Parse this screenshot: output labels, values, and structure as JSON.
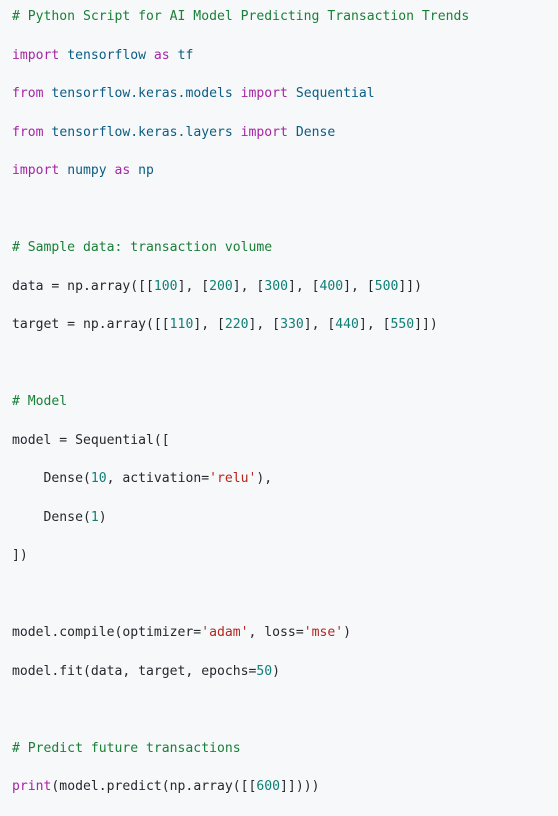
{
  "code": {
    "language": "python",
    "lines": [
      [
        {
          "t": "# Python Script for AI Model Predicting Transaction Trends",
          "c": "comment"
        }
      ],
      [
        {
          "t": "import",
          "c": "kw"
        },
        {
          "t": " tensorflow ",
          "c": "mod"
        },
        {
          "t": "as",
          "c": "kw"
        },
        {
          "t": " tf",
          "c": "mod"
        }
      ],
      [
        {
          "t": "from",
          "c": "kw"
        },
        {
          "t": " tensorflow.keras.models ",
          "c": "mod"
        },
        {
          "t": "import",
          "c": "kw"
        },
        {
          "t": " Sequential",
          "c": "mod"
        }
      ],
      [
        {
          "t": "from",
          "c": "kw"
        },
        {
          "t": " tensorflow.keras.layers ",
          "c": "mod"
        },
        {
          "t": "import",
          "c": "kw"
        },
        {
          "t": " Dense",
          "c": "mod"
        }
      ],
      [
        {
          "t": "import",
          "c": "kw"
        },
        {
          "t": " numpy ",
          "c": "mod"
        },
        {
          "t": "as",
          "c": "kw"
        },
        {
          "t": " np",
          "c": "mod"
        }
      ],
      [],
      [
        {
          "t": "# Sample data: transaction volume",
          "c": "comment"
        }
      ],
      [
        {
          "t": "data = np.array([[",
          "c": "fn"
        },
        {
          "t": "100",
          "c": "num"
        },
        {
          "t": "], [",
          "c": "fn"
        },
        {
          "t": "200",
          "c": "num"
        },
        {
          "t": "], [",
          "c": "fn"
        },
        {
          "t": "300",
          "c": "num"
        },
        {
          "t": "], [",
          "c": "fn"
        },
        {
          "t": "400",
          "c": "num"
        },
        {
          "t": "], [",
          "c": "fn"
        },
        {
          "t": "500",
          "c": "num"
        },
        {
          "t": "]])",
          "c": "fn"
        }
      ],
      [
        {
          "t": "target = np.array([[",
          "c": "fn"
        },
        {
          "t": "110",
          "c": "num"
        },
        {
          "t": "], [",
          "c": "fn"
        },
        {
          "t": "220",
          "c": "num"
        },
        {
          "t": "], [",
          "c": "fn"
        },
        {
          "t": "330",
          "c": "num"
        },
        {
          "t": "], [",
          "c": "fn"
        },
        {
          "t": "440",
          "c": "num"
        },
        {
          "t": "], [",
          "c": "fn"
        },
        {
          "t": "550",
          "c": "num"
        },
        {
          "t": "]])",
          "c": "fn"
        }
      ],
      [],
      [
        {
          "t": "# Model",
          "c": "comment"
        }
      ],
      [
        {
          "t": "model = Sequential([",
          "c": "fn"
        }
      ],
      [
        {
          "t": "    Dense(",
          "c": "fn"
        },
        {
          "t": "10",
          "c": "num"
        },
        {
          "t": ", activation=",
          "c": "fn"
        },
        {
          "t": "'relu'",
          "c": "str"
        },
        {
          "t": "),",
          "c": "fn"
        }
      ],
      [
        {
          "t": "    Dense(",
          "c": "fn"
        },
        {
          "t": "1",
          "c": "num"
        },
        {
          "t": ")",
          "c": "fn"
        }
      ],
      [
        {
          "t": "])",
          "c": "fn"
        }
      ],
      [],
      [
        {
          "t": "model.compile(optimizer=",
          "c": "fn"
        },
        {
          "t": "'adam'",
          "c": "str"
        },
        {
          "t": ", loss=",
          "c": "fn"
        },
        {
          "t": "'mse'",
          "c": "str"
        },
        {
          "t": ")",
          "c": "fn"
        }
      ],
      [
        {
          "t": "model.fit(data, target, epochs=",
          "c": "fn"
        },
        {
          "t": "50",
          "c": "num"
        },
        {
          "t": ")",
          "c": "fn"
        }
      ],
      [],
      [
        {
          "t": "# Predict future transactions",
          "c": "comment"
        }
      ],
      [
        {
          "t": "print",
          "c": "kw"
        },
        {
          "t": "(model.predict(np.array([[",
          "c": "fn"
        },
        {
          "t": "600",
          "c": "num"
        },
        {
          "t": "]])))",
          "c": "fn"
        }
      ]
    ]
  },
  "colors": {
    "background": "#f6f8fa",
    "comment": "#1a7f37",
    "keyword": "#a626a4",
    "number": "#0f7f75",
    "string": "#b3261e",
    "module": "#0b5d83",
    "text": "#24292e"
  }
}
